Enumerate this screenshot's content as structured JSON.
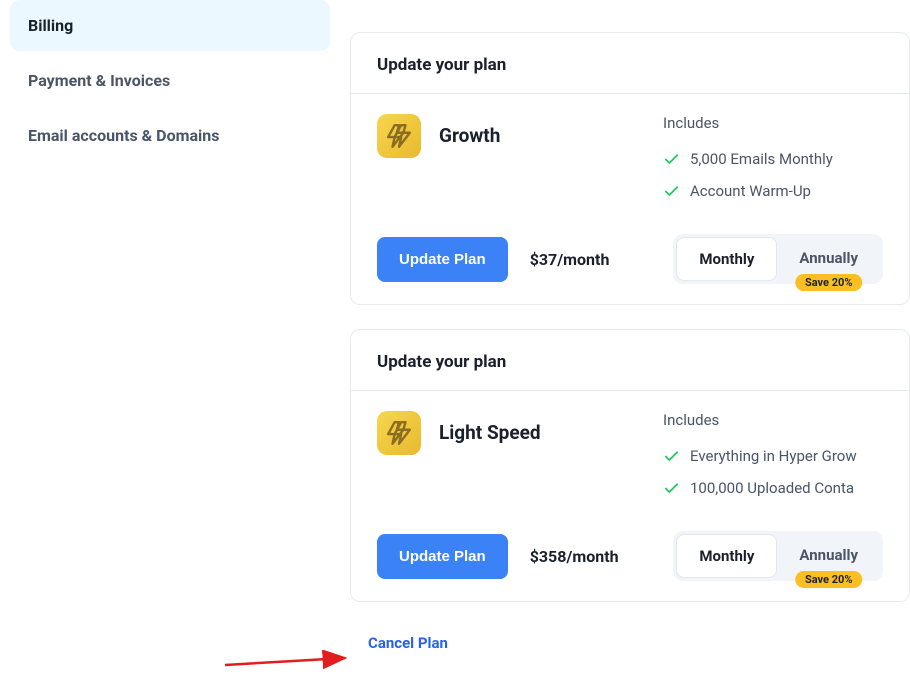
{
  "sidebar": {
    "items": [
      {
        "label": "Billing",
        "active": true
      },
      {
        "label": "Payment & Invoices",
        "active": false
      },
      {
        "label": "Email accounts & Domains",
        "active": false
      }
    ]
  },
  "plans": [
    {
      "header": "Update your plan",
      "name": "Growth",
      "includes_label": "Includes",
      "features": [
        "5,000 Emails Monthly",
        "Account Warm-Up"
      ],
      "update_label": "Update Plan",
      "price": "$37/month",
      "toggle": {
        "monthly": "Monthly",
        "annually": "Annually",
        "save": "Save 20%",
        "selected": "monthly"
      }
    },
    {
      "header": "Update your plan",
      "name": "Light Speed",
      "includes_label": "Includes",
      "features": [
        "Everything in Hyper Grow",
        "100,000 Uploaded Conta"
      ],
      "update_label": "Update Plan",
      "price": "$358/month",
      "toggle": {
        "monthly": "Monthly",
        "annually": "Annually",
        "save": "Save 20%",
        "selected": "monthly"
      }
    }
  ],
  "cancel_label": "Cancel Plan"
}
